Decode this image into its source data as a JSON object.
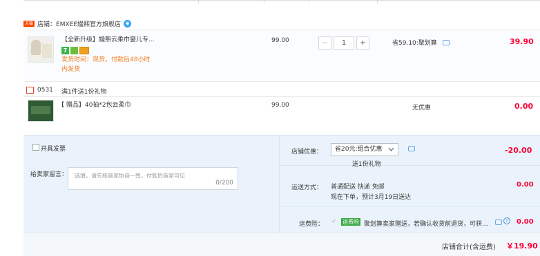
{
  "shop": {
    "tag": "天猫",
    "name": "店铺：EMXEE嫚熙官方旗舰店"
  },
  "item1": {
    "title": "【全新升级】嫚熙云柔巾婴儿专...",
    "ship_time": "发货时间：现货，付款后48小时",
    "ship_time_2": "内发货",
    "unit_price": "99.00",
    "quantity": "1",
    "minus": "−",
    "plus": "+",
    "promo": "省59.10:聚划算",
    "subtotal": "39.90",
    "icon_7": "7"
  },
  "gift_section": {
    "rule_id": "0531",
    "rule_text": "满1件送1份礼物"
  },
  "item2": {
    "title": "【 赠品】40抽*2包云柔巾",
    "unit_price": "99.00",
    "promo": "无优惠",
    "subtotal": "0.00"
  },
  "invoice": {
    "label": "开具发票"
  },
  "message": {
    "label": "给卖家留言：",
    "placeholder": "选填，请先和商家协商一致，付款后商家可见",
    "counter": "0/200"
  },
  "shop_discount": {
    "label": "店铺优惠：",
    "selected": "省20元:组合优惠",
    "sub": "送1份礼物",
    "amount": "-20.00"
  },
  "delivery": {
    "label": "运送方式：",
    "line1": "普通配送 快递 免邮",
    "line2": "现在下单，预计3月19日送达",
    "amount": "0.00"
  },
  "insurance": {
    "label": "运费险：",
    "tag": "运费险",
    "text": "聚划算卖家赠送，若确认收货前退货，可获...",
    "amount": "0.00",
    "help": "?"
  },
  "footer": {
    "label": "店铺合计(含运费)",
    "total": "￥19.90"
  },
  "colors": {
    "price_red": "#ff0036",
    "orange": "#f17c1d",
    "panel_bg": "#eaf3fb",
    "tmall_red": "#ff4400"
  }
}
